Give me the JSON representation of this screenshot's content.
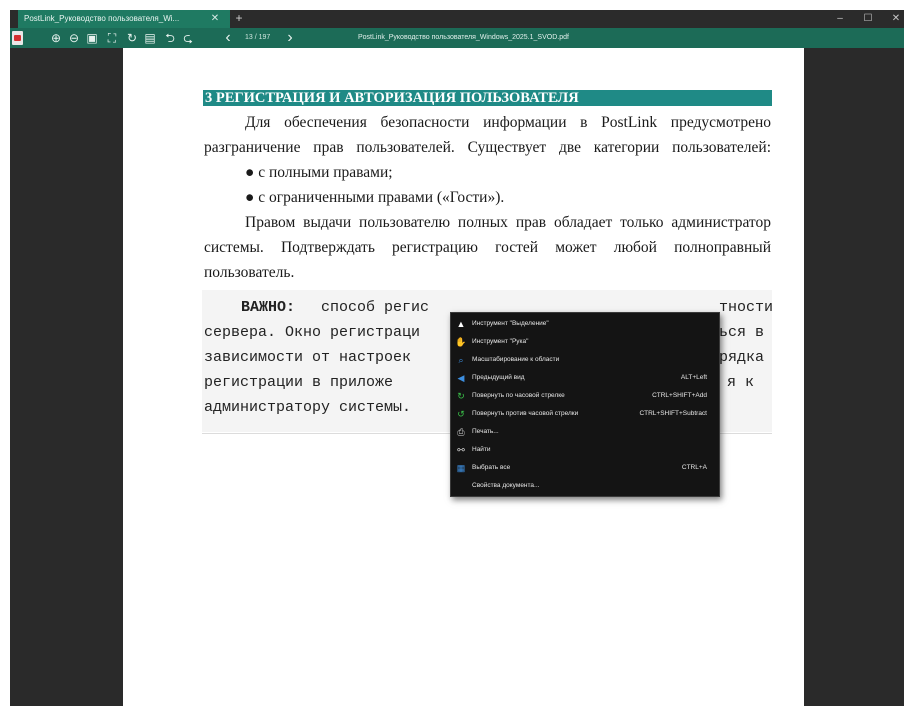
{
  "window": {
    "tab_title": "PostLink_Руководство пользователя_Wi...",
    "tab_close": "✕",
    "new_tab": "+",
    "minimize": "–",
    "maximize": "☐",
    "close": "✕"
  },
  "toolbar": {
    "zoom_in": "⊕",
    "zoom_out": "⊖",
    "fit_page": "▣",
    "fit_width": "⛶",
    "rotate": "↻",
    "print": "▤",
    "undo": "⮌",
    "redo": "⮎",
    "prev_page": "‹",
    "page_indicator": "13 / 197",
    "next_page": "›",
    "document_title": "PostLink_Руководство пользователя_Windows_2025.1_SVOD.pdf"
  },
  "document": {
    "heading": "3 РЕГИСТРАЦИЯ И АВТОРИЗАЦИЯ ПОЛЬЗОВАТЕЛЯ",
    "para1_line1": "Для обеспечения безопасности информации в PostLink предусмотрено",
    "para1_line2": "разграничение прав пользователей. Существует две категории пользователей:",
    "bullet1": "● с полными правами;",
    "bullet2": "● с ограниченными правами («Гости»).",
    "para2_line1": "Правом выдачи пользователю полных прав обладает только администратор",
    "para2_line2": "системы. Подтверждать регистрацию гостей может любой полноправный",
    "para2_line3": "пользователь.",
    "note_bold": "ВАЖНО:",
    "note_line1_rest": "способ регис",
    "note_line1_end": "тности",
    "note_line2_start": "сервера. Окно регистраци",
    "note_line2_end": "ься в",
    "note_line3_start": "зависимости от настроек",
    "note_line3_end": "рядка",
    "note_line4_start": "регистрации  в  приложе",
    "note_line4_end": "я  к",
    "note_line5": "администратору системы."
  },
  "context_menu": {
    "items": [
      {
        "label": "Инструмент \"Выделение\"",
        "shortcut": "",
        "icon": "cursor-icon",
        "glyph": "▲",
        "color": "#ffffff"
      },
      {
        "label": "Инструмент \"Рука\"",
        "shortcut": "",
        "icon": "hand-icon",
        "glyph": "✋",
        "color": "#e0b070"
      },
      {
        "label": "Масштабирование к области",
        "shortcut": "",
        "icon": "zoom-area-icon",
        "glyph": "⌕",
        "color": "#3d8fe0"
      },
      {
        "label": "Предыдущий вид",
        "shortcut": "ALT+Left",
        "icon": "previous-view-icon",
        "glyph": "◀",
        "color": "#3d8fe0"
      },
      {
        "label": "Повернуть по часовой стрелке",
        "shortcut": "CTRL+SHIFT+Add",
        "icon": "rotate-clockwise-icon",
        "glyph": "↻",
        "color": "#3ac24a"
      },
      {
        "label": "Повернуть против часовой стрелки",
        "shortcut": "CTRL+SHIFT+Subtract",
        "icon": "rotate-counterclockwise-icon",
        "glyph": "↺",
        "color": "#3ac24a"
      },
      {
        "label": "Печать...",
        "shortcut": "",
        "icon": "print-icon",
        "glyph": "⎙",
        "color": "#d8d8d8"
      },
      {
        "label": "Найти",
        "shortcut": "",
        "icon": "binoculars-icon",
        "glyph": "⚯",
        "color": "#d8d8d8"
      },
      {
        "label": "Выбрать все",
        "shortcut": "CTRL+A",
        "icon": "select-all-icon",
        "glyph": "▦",
        "color": "#3d8fe0"
      },
      {
        "label": "Свойства документа...",
        "shortcut": "",
        "icon": "",
        "glyph": "",
        "color": "#d8d8d8"
      }
    ]
  },
  "colors": {
    "tab_bg": "#1f7a62",
    "toolbar_bg": "#1c6b57",
    "heading_bg": "#1f8a86",
    "menu_bg": "#141414"
  }
}
